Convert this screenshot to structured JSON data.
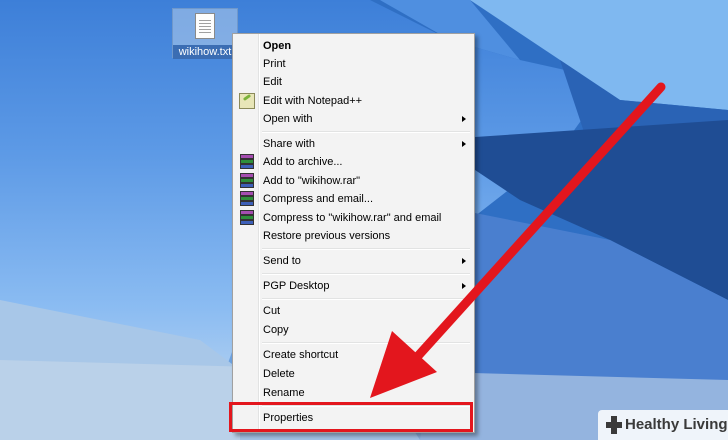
{
  "desktop": {
    "file_icon": {
      "name": "wikihow.txt",
      "icon": "text-file-icon"
    }
  },
  "context_menu": {
    "items": [
      {
        "label": "Open",
        "bold": true
      },
      {
        "label": "Print"
      },
      {
        "label": "Edit"
      },
      {
        "label": "Edit with Notepad++",
        "icon": "notepad-plus-plus-icon"
      },
      {
        "label": "Open with",
        "submenu": true
      },
      {
        "label": "Share with",
        "submenu": true
      },
      {
        "label": "Add to archive...",
        "icon": "winrar-icon"
      },
      {
        "label": "Add to \"wikihow.rar\"",
        "icon": "winrar-icon"
      },
      {
        "label": "Compress and email...",
        "icon": "winrar-icon"
      },
      {
        "label": "Compress to \"wikihow.rar\" and email",
        "icon": "winrar-icon"
      },
      {
        "label": "Restore previous versions"
      },
      {
        "label": "Send to",
        "submenu": true
      },
      {
        "label": "PGP Desktop",
        "submenu": true
      },
      {
        "label": "Cut"
      },
      {
        "label": "Copy"
      },
      {
        "label": "Create shortcut"
      },
      {
        "label": "Delete"
      },
      {
        "label": "Rename"
      },
      {
        "label": "Properties",
        "highlighted": true
      }
    ]
  },
  "annotation": {
    "arrow_color": "#e3161d",
    "highlight_color": "#e3161d"
  },
  "watermark": {
    "text": "Healthy Living",
    "icon": "plus-cross-icon"
  }
}
